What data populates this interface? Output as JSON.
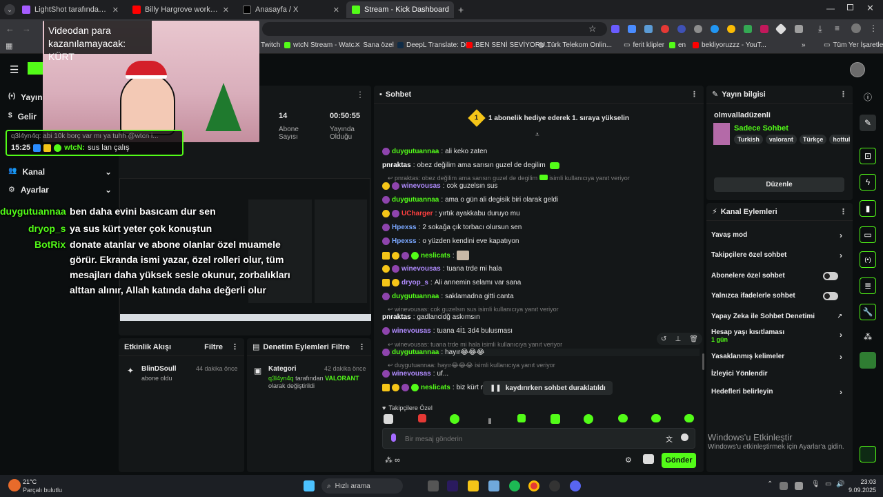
{
  "browser": {
    "tabs": [
      {
        "title": "LightShot tarafından Ekran Gör...",
        "active": false
      },
      {
        "title": "Billy Hargrove working out [Str...",
        "active": false
      },
      {
        "title": "Anasayfa / X",
        "active": false
      },
      {
        "title": "Stream - Kick Dashboard",
        "active": true
      }
    ],
    "bookmarks": [
      "Twitch",
      "wtcN Stream - Watc...",
      "Sana özel",
      "DeepL Translate: Dü...",
      "BEN SENİ SEVİYORU...",
      "Türk Telekom Onlin...",
      "ferit klipler",
      "en",
      "bekliyoruzzz - YouT...",
      "Tüm Yer İşaretleri"
    ]
  },
  "overlay": {
    "monetization_notice": "Videodan para kazanılamayacak: KÜRT",
    "pinned_reply": "q3l4yn4q: abi 10k borç var mı ya tuhh @wtcn i...",
    "pinned_time": "15:25",
    "pinned_user": "wtcN:",
    "pinned_msg": "sus lan çalış",
    "chat": [
      {
        "user": "duygutuannaa",
        "msg": "ben daha evini basıcam dur sen"
      },
      {
        "user": "dryop_s",
        "msg": "ya sus kürt yeter çok konuştun"
      },
      {
        "user": "BotRix",
        "msg": "donate atanlar ve abone olanlar özel muamele"
      }
    ],
    "botrix_cont": [
      "görür. Ekranda ismi yazar, özel rolleri olur, tüm",
      "mesajları daha yüksek sesle okunur, zorbalıkları",
      "alttan alınır, Allah katında daha değerli olur"
    ]
  },
  "sidebar": {
    "items": [
      "Yayın",
      "Gelir",
      "Kanal",
      "Ayarlar"
    ]
  },
  "stream": {
    "subs_value": "14",
    "subs_label": "Abone Sayısı",
    "uptime_value": "00:50:55",
    "uptime_label": "Yayında Olduğu"
  },
  "activity": {
    "title": "Etkinlik Akışı",
    "filter": "Filtre",
    "item_user": "BlinDSoull",
    "item_desc": "abone oldu",
    "item_time": "44 dakika önce"
  },
  "moderation": {
    "title": "Denetim Eylemleri",
    "filter": "Filtre",
    "item_title": "Kategori",
    "item_time": "42 dakika önce",
    "item_actor": "q3l4yn4q",
    "item_mid": "tarafından",
    "item_cat": "VALORANT",
    "item_end": "olarak değiştirildi"
  },
  "chat": {
    "title": "Sohbet",
    "gift_banner": "1 abonelik hediye ederek 1. sıraya yükselin",
    "messages": [
      {
        "user": "duygutuannaa",
        "color": "#53fc18",
        "msg": "ali keko zaten"
      },
      {
        "user": "pnraktas",
        "color": "#ffffff",
        "msg": "obez değilim ama sarısın guzel de degilim"
      },
      {
        "user": "winevousas",
        "color": "#b18cff",
        "msg": "cok guzelsın sus"
      },
      {
        "user": "duygutuannaa",
        "color": "#53fc18",
        "msg": "ama o gün ali degisik biri olarak geldi"
      },
      {
        "user": "UCharger",
        "color": "#ff4040",
        "msg": "yırtık ayakkabu duruyo mu"
      },
      {
        "user": "Hpexss",
        "color": "#7aa7ff",
        "msg": "2 sokağa çık torbacı olursun sen"
      },
      {
        "user": "Hpexss",
        "color": "#7aa7ff",
        "msg": "o yüzden kendini eve kapatıyon"
      },
      {
        "user": "neslicats",
        "color": "#53fc18",
        "msg": ""
      },
      {
        "user": "winevousas",
        "color": "#b18cff",
        "msg": "tuana trde mi hala"
      },
      {
        "user": "dryop_s",
        "color": "#b18cff",
        "msg": "Ali annemin selamı var sana"
      },
      {
        "user": "duygutuannaa",
        "color": "#53fc18",
        "msg": "saklamadna gitti canta"
      },
      {
        "user": "pnraktas",
        "color": "#ffffff",
        "msg": "gadlancidğ askımsın"
      },
      {
        "user": "winevousas",
        "color": "#b18cff",
        "msg": "tuana 4İ1 3d4 bulusması"
      },
      {
        "user": "duygutuannaa",
        "color": "#53fc18",
        "msg": "hayır😂😂😂"
      },
      {
        "user": "winevousas",
        "color": "#b18cff",
        "msg": "uf..."
      },
      {
        "user": "neslicats",
        "color": "#53fc18",
        "msg": "biz kürt mi"
      }
    ],
    "replies": [
      "pnraktas: obez değilim ama sarısın guzel de degilim",
      "winevousas: cok guzelsın sus isimli kullanıcıya yanıt veriyor",
      "winevousas: tuana trde mi hala isimli kullanıcıya yanıt veriyor",
      "duygutuannaa: hayır😂😂😂 isimli kullanıcıya yanıt veriyor"
    ],
    "reply_suffix": "isimli kullanıcıya yanıt veriyor",
    "paused": "kaydırırken sohbet duraklatıldı",
    "followers_only": "Takipçilere Özel",
    "input_placeholder": "Bir mesaj gönderin",
    "send": "Gönder"
  },
  "stream_info": {
    "title": "Yayın bilgisi",
    "stream_title": "olmvalladüzenli",
    "category": "Sadece Sohbet",
    "tags": [
      "Turkish",
      "valorant",
      "Türkçe",
      "hottul"
    ],
    "edit": "Düzenle"
  },
  "channel_actions": {
    "title": "Kanal Eylemleri",
    "items": [
      {
        "label": "Yavaş mod",
        "type": "chevron"
      },
      {
        "label": "Takipçilere özel sohbet",
        "type": "chevron"
      },
      {
        "label": "Abonelere özel sohbet",
        "type": "toggle"
      },
      {
        "label": "Yalnızca ifadelerle sohbet",
        "type": "toggle"
      },
      {
        "label": "Yapay Zeka ile Sohbet Denetimi",
        "type": "external"
      },
      {
        "label": "Hesap yaşı kısıtlaması",
        "type": "chevron",
        "sub": "1 gün"
      },
      {
        "label": "Yasaklanmış kelimeler",
        "type": "chevron"
      },
      {
        "label": "İzleyici Yönlendir",
        "type": "none"
      },
      {
        "label": "Hedefleri belirleyin",
        "type": "chevron"
      }
    ]
  },
  "windows": {
    "activate_title": "Windows'u Etkinleştir",
    "activate_sub": "Windows'u etkinleştirmek için Ayarlar'a gidin.",
    "weather_temp": "21°C",
    "weather_desc": "Parçalı bulutlu",
    "search": "Hızlı arama",
    "time": "23:03",
    "date": "9.09.2025"
  },
  "colors": {
    "accent": "#53fc18",
    "panel": "#141718",
    "background": "#0b0e0f"
  }
}
